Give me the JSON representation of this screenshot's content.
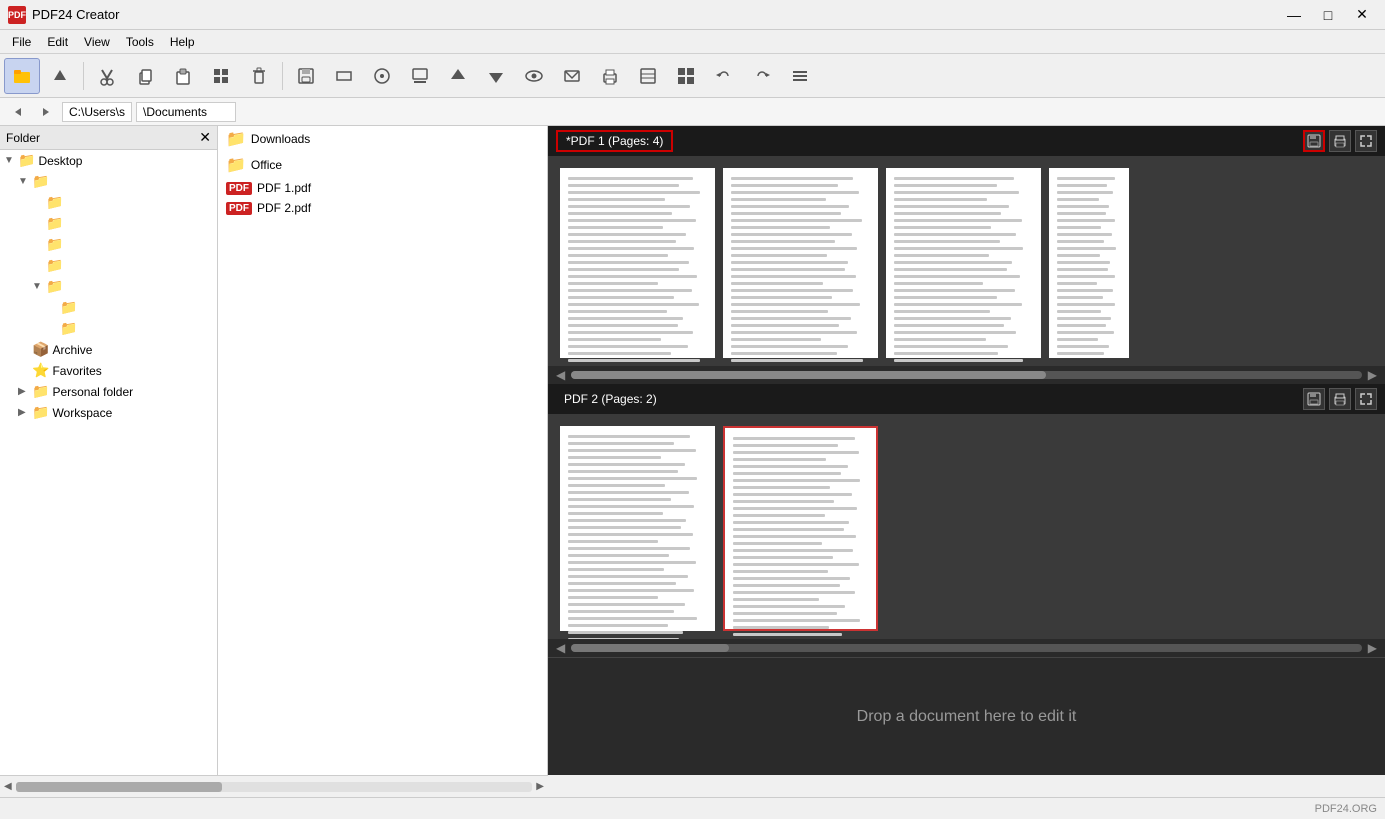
{
  "app": {
    "title": "PDF24 Creator",
    "icon": "PDF"
  },
  "titlebar": {
    "minimize": "—",
    "maximize": "□",
    "close": "✕"
  },
  "menu": {
    "items": [
      "File",
      "Edit",
      "View",
      "Tools",
      "Help"
    ]
  },
  "toolbar": {
    "buttons": [
      {
        "name": "folder",
        "icon": "📁"
      },
      {
        "name": "up",
        "icon": "⬆"
      },
      {
        "name": "cut",
        "icon": "✂"
      },
      {
        "name": "copy",
        "icon": "⧉"
      },
      {
        "name": "paste",
        "icon": "📋"
      },
      {
        "name": "grid",
        "icon": "⊞"
      },
      {
        "name": "delete",
        "icon": "🗑"
      },
      {
        "name": "save",
        "icon": "💾"
      },
      {
        "name": "rect",
        "icon": "▭"
      },
      {
        "name": "circle",
        "icon": "◎"
      },
      {
        "name": "stamp",
        "icon": "⎅"
      },
      {
        "name": "arrow-up",
        "icon": "↑"
      },
      {
        "name": "arrow-down",
        "icon": "↓"
      },
      {
        "name": "preview",
        "icon": "👁"
      },
      {
        "name": "email",
        "icon": "✉"
      },
      {
        "name": "print",
        "icon": "🖨"
      },
      {
        "name": "compress",
        "icon": "⧖"
      },
      {
        "name": "grid2",
        "icon": "⊞"
      },
      {
        "name": "rotate-left",
        "icon": "↺"
      },
      {
        "name": "rotate-right",
        "icon": "↻"
      },
      {
        "name": "menu2",
        "icon": "≡"
      }
    ]
  },
  "addressbar": {
    "path": "C:\\Users\\s",
    "path2": "\\Documents"
  },
  "folder_panel": {
    "header": "Folder",
    "close_btn": "✕",
    "tree": [
      {
        "label": "Desktop",
        "level": 0,
        "type": "folder",
        "expanded": true,
        "has_arrow": true
      },
      {
        "label": "",
        "level": 1,
        "type": "folder",
        "expanded": true,
        "has_arrow": true
      },
      {
        "label": "",
        "level": 2,
        "type": "folder",
        "expanded": false,
        "has_arrow": false
      },
      {
        "label": "",
        "level": 2,
        "type": "folder",
        "expanded": false,
        "has_arrow": false
      },
      {
        "label": "",
        "level": 2,
        "type": "folder",
        "expanded": false,
        "has_arrow": false
      },
      {
        "label": "",
        "level": 2,
        "type": "folder",
        "expanded": false,
        "has_arrow": false
      },
      {
        "label": "",
        "level": 2,
        "type": "folder",
        "expanded": true,
        "has_arrow": true
      },
      {
        "label": "",
        "level": 3,
        "type": "folder",
        "expanded": false
      },
      {
        "label": "",
        "level": 3,
        "type": "folder",
        "expanded": false
      },
      {
        "label": "Archive",
        "level": 1,
        "type": "special",
        "expanded": false
      },
      {
        "label": "Favorites",
        "level": 1,
        "type": "star",
        "expanded": false
      },
      {
        "label": "Personal folder",
        "level": 1,
        "type": "special",
        "expanded": false,
        "has_arrow": true
      },
      {
        "label": "Workspace",
        "level": 1,
        "type": "workspace",
        "expanded": false,
        "has_arrow": true
      }
    ]
  },
  "file_list": {
    "items": [
      {
        "name": "Downloads",
        "type": "folder"
      },
      {
        "name": "Office",
        "type": "folder"
      },
      {
        "name": "PDF 1.pdf",
        "type": "pdf"
      },
      {
        "name": "PDF 2.pdf",
        "type": "pdf"
      }
    ]
  },
  "pdf_workspace": {
    "doc1": {
      "title": "*PDF 1 (Pages: 4)",
      "pages": 4,
      "selected_page": 0
    },
    "doc2": {
      "title": "PDF 2 (Pages: 2)",
      "pages": 2,
      "selected_page": 1
    },
    "drop_zone": "Drop a document here to edit it"
  },
  "statusbar": {
    "text": "PDF24.ORG"
  }
}
